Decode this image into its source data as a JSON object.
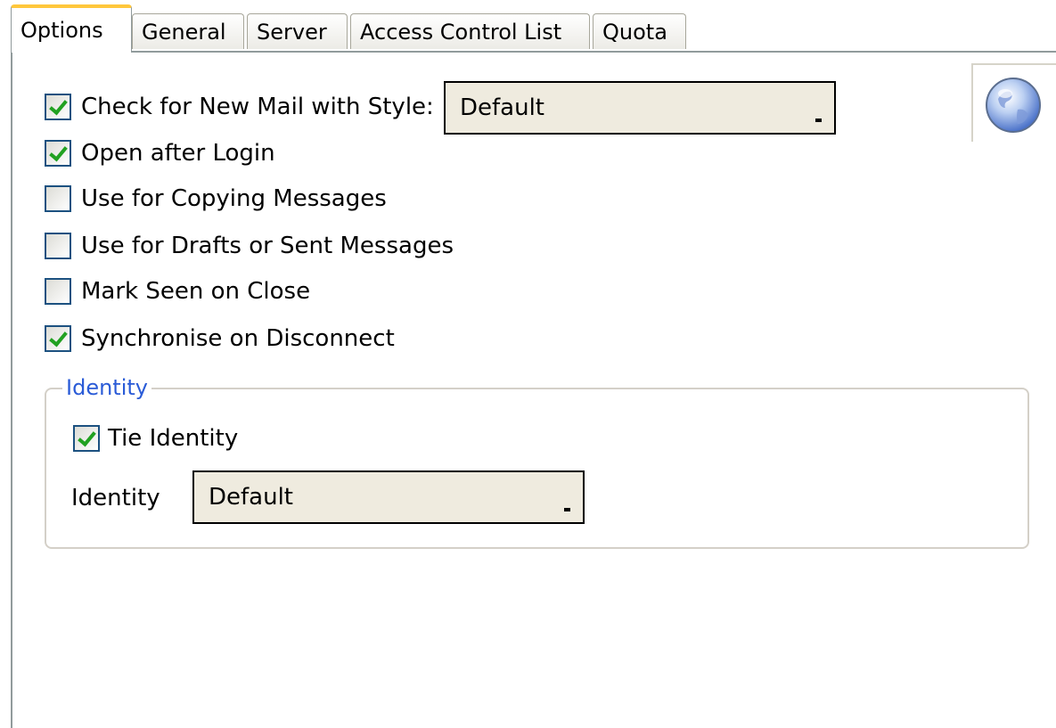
{
  "tabs": [
    {
      "label": "Options",
      "active": true
    },
    {
      "label": "General",
      "active": false
    },
    {
      "label": "Server",
      "active": false
    },
    {
      "label": "Access Control List",
      "active": false
    },
    {
      "label": "Quota",
      "active": false
    }
  ],
  "options": {
    "check_new_mail": {
      "label": "Check for New Mail with Style:",
      "checked": true
    },
    "style_select": {
      "value": "Default"
    },
    "open_after_login": {
      "label": "Open after Login",
      "checked": true
    },
    "use_for_copying": {
      "label": "Use for Copying Messages",
      "checked": false
    },
    "use_for_drafts": {
      "label": "Use for Drafts or Sent Messages",
      "checked": false
    },
    "mark_seen": {
      "label": "Mark Seen on Close",
      "checked": false
    },
    "synchronise": {
      "label": "Synchronise on Disconnect",
      "checked": true
    }
  },
  "identity_group": {
    "legend": "Identity",
    "tie_identity": {
      "label": "Tie Identity",
      "checked": true
    },
    "identity_label": "Identity",
    "identity_select": {
      "value": "Default"
    }
  },
  "icons": {
    "globe": "globe-icon"
  },
  "colors": {
    "active_tab_accent": "#ffc73c",
    "check_mark": "#21a121",
    "group_legend": "#2a5bd7",
    "select_background": "#efebdf"
  }
}
